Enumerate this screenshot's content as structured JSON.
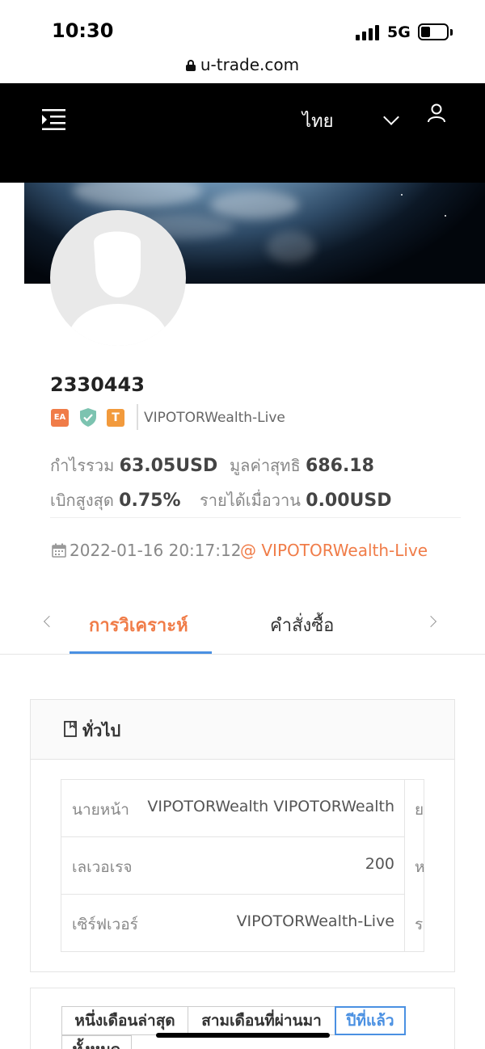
{
  "status_bar": {
    "time": "10:30",
    "network": "5G"
  },
  "browser": {
    "url": "u-trade.com"
  },
  "header": {
    "language": "ไทย"
  },
  "profile": {
    "account_id": "2330443",
    "badges": [
      "EA",
      "T"
    ],
    "broker": "VIPOTORWealth-Live",
    "stats": [
      {
        "label": "กำไรรวม",
        "value": "63.05USD"
      },
      {
        "label": "มูลค่าสุทธิ",
        "value": "686.18"
      },
      {
        "label": "เบิกสูงสุด",
        "value": "0.75%"
      },
      {
        "label": "รายได้เมื่อวาน",
        "value": "0.00USD"
      }
    ],
    "date": "2022-01-16 20:17:12",
    "at_server": "@ VIPOTORWealth-Live"
  },
  "tabs": [
    {
      "label": "การวิเคราะห์",
      "active": true
    },
    {
      "label": "คำสั่งซื้อ",
      "active": false
    }
  ],
  "general_card": {
    "title": "ทั่วไป",
    "rows": [
      {
        "key": "นายหน้า",
        "value": "VIPOTORWealth VIPOTORWealth",
        "clipped": "ย"
      },
      {
        "key": "เลเวอเรจ",
        "value": "200",
        "clipped": "ห"
      },
      {
        "key": "เซิร์ฟเวอร์",
        "value": "VIPOTORWealth-Live",
        "clipped": "ร"
      }
    ]
  },
  "period_filter": {
    "options": [
      "หนึ่งเดือนล่าสุด",
      "สามเดือนที่ผ่านมา",
      "ปีที่แล้ว",
      "ทั้งหมด"
    ],
    "selected": "ปีที่แล้ว"
  },
  "colors": {
    "accent": "#f07c48",
    "link_blue": "#4a90e2",
    "header_bg": "#000000"
  }
}
